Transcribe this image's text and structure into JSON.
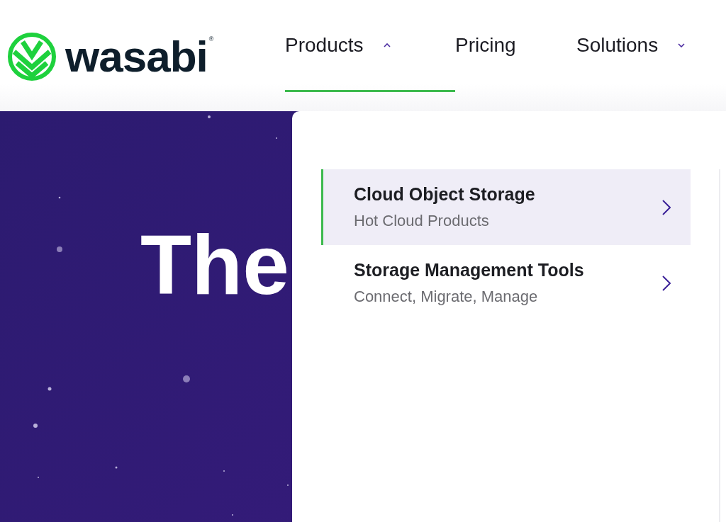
{
  "brand": {
    "name": "wasabi",
    "mark": "®"
  },
  "nav": [
    {
      "label": "Products",
      "kind": "dropdown",
      "expanded": true,
      "selected": true
    },
    {
      "label": "Pricing",
      "kind": "link",
      "selected": false
    },
    {
      "label": "Solutions",
      "kind": "dropdown",
      "expanded": false,
      "selected": false
    }
  ],
  "hero": {
    "heading": "The"
  },
  "menu": [
    {
      "title": "Cloud Object Storage",
      "subtitle": "Hot Cloud Products",
      "selected": true
    },
    {
      "title": "Storage Management Tools",
      "subtitle": "Connect, Migrate, Manage",
      "selected": false
    }
  ]
}
